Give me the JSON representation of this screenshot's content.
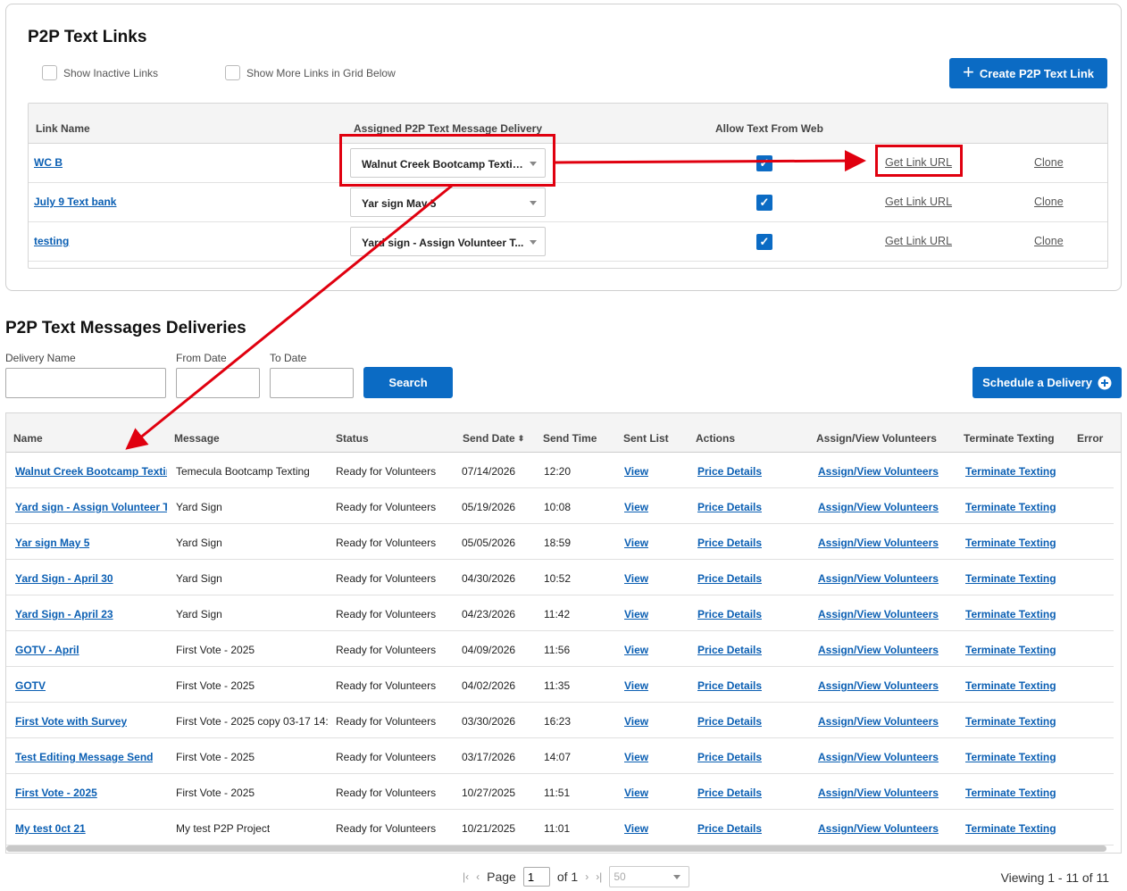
{
  "links_panel": {
    "title": "P2P Text Links",
    "show_inactive_label": "Show Inactive Links",
    "show_more_label": "Show More Links in Grid Below",
    "create_button": "Create P2P Text Link",
    "headers": {
      "name": "Link Name",
      "delivery": "Assigned P2P Text Message Delivery",
      "allow": "Allow Text From Web"
    },
    "rows": [
      {
        "name": "WC B",
        "delivery": "Walnut Creek Bootcamp Texting",
        "allow_checked": true,
        "get_link": "Get Link URL",
        "clone": "Clone"
      },
      {
        "name": "July 9 Text bank",
        "delivery": "Yar sign May 5",
        "allow_checked": true,
        "get_link": "Get Link URL",
        "clone": "Clone"
      },
      {
        "name": "testing",
        "delivery": "Yard sign - Assign Volunteer T...",
        "allow_checked": true,
        "get_link": "Get Link URL",
        "clone": "Clone"
      }
    ],
    "check_glyph": "✓"
  },
  "deliveries": {
    "title": "P2P Text Messages Deliveries",
    "filters": {
      "delivery_name": "Delivery Name",
      "from_date": "From Date",
      "to_date": "To Date"
    },
    "search_button": "Search",
    "schedule_button": "Schedule a Delivery",
    "headers": {
      "name": "Name",
      "message": "Message",
      "status": "Status",
      "send_date": "Send Date",
      "send_time": "Send Time",
      "sent_list": "Sent List",
      "actions": "Actions",
      "assign": "Assign/View Volunteers",
      "terminate": "Terminate Texting",
      "error": "Error"
    },
    "rows": [
      {
        "name": "Walnut Creek Bootcamp Texting",
        "message": "Temecula Bootcamp Texting",
        "status": "Ready for Volunteers",
        "date": "07/14/2026",
        "time": "12:20",
        "view": "View",
        "price": "Price Details",
        "assign": "Assign/View Volunteers",
        "terminate": "Terminate Texting"
      },
      {
        "name": "Yard sign - Assign Volunteer Texting",
        "message": "Yard Sign",
        "status": "Ready for Volunteers",
        "date": "05/19/2026",
        "time": "10:08",
        "view": "View",
        "price": "Price Details",
        "assign": "Assign/View Volunteers",
        "terminate": "Terminate Texting"
      },
      {
        "name": "Yar sign May 5",
        "message": "Yard Sign",
        "status": "Ready for Volunteers",
        "date": "05/05/2026",
        "time": "18:59",
        "view": "View",
        "price": "Price Details",
        "assign": "Assign/View Volunteers",
        "terminate": "Terminate Texting"
      },
      {
        "name": "Yard Sign -  April 30",
        "message": "Yard Sign",
        "status": "Ready for Volunteers",
        "date": "04/30/2026",
        "time": "10:52",
        "view": "View",
        "price": "Price Details",
        "assign": "Assign/View Volunteers",
        "terminate": "Terminate Texting"
      },
      {
        "name": "Yard Sign - April 23",
        "message": "Yard Sign",
        "status": "Ready for Volunteers",
        "date": "04/23/2026",
        "time": "11:42",
        "view": "View",
        "price": "Price Details",
        "assign": "Assign/View Volunteers",
        "terminate": "Terminate Texting"
      },
      {
        "name": "GOTV - April",
        "message": "First Vote - 2025",
        "status": "Ready for Volunteers",
        "date": "04/09/2026",
        "time": "11:56",
        "view": "View",
        "price": "Price Details",
        "assign": "Assign/View Volunteers",
        "terminate": "Terminate Texting"
      },
      {
        "name": "GOTV",
        "message": "First Vote - 2025",
        "status": "Ready for Volunteers",
        "date": "04/02/2026",
        "time": "11:35",
        "view": "View",
        "price": "Price Details",
        "assign": "Assign/View Volunteers",
        "terminate": "Terminate Texting"
      },
      {
        "name": "First Vote with Survey",
        "message": "First Vote - 2025 copy 03-17 14:",
        "status": "Ready for Volunteers",
        "date": "03/30/2026",
        "time": "16:23",
        "view": "View",
        "price": "Price Details",
        "assign": "Assign/View Volunteers",
        "terminate": "Terminate Texting"
      },
      {
        "name": "Test Editing Message Send",
        "message": "First Vote - 2025",
        "status": "Ready for Volunteers",
        "date": "03/17/2026",
        "time": "14:07",
        "view": "View",
        "price": "Price Details",
        "assign": "Assign/View Volunteers",
        "terminate": "Terminate Texting"
      },
      {
        "name": "First Vote - 2025",
        "message": "First Vote - 2025",
        "status": "Ready for Volunteers",
        "date": "10/27/2025",
        "time": "11:51",
        "view": "View",
        "price": "Price Details",
        "assign": "Assign/View Volunteers",
        "terminate": "Terminate Texting"
      },
      {
        "name": "My test 0ct 21",
        "message": "My test P2P Project",
        "status": "Ready for Volunteers",
        "date": "10/21/2025",
        "time": "11:01",
        "view": "View",
        "price": "Price Details",
        "assign": "Assign/View Volunteers",
        "terminate": "Terminate Texting"
      }
    ]
  },
  "pager": {
    "page_label": "Page",
    "page_value": "1",
    "of_label": "of 1",
    "page_size": "50",
    "viewing": "Viewing 1 - 11 of 11",
    "first_icon": "|‹",
    "prev_icon": "‹",
    "next_icon": "›",
    "last_icon": "›|"
  },
  "colors": {
    "accent": "#0b6bc4",
    "link": "#0b5fb3",
    "annotation": "#e0000f"
  }
}
